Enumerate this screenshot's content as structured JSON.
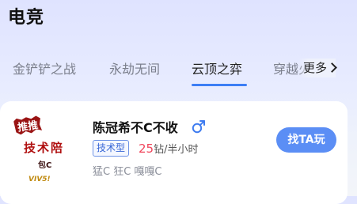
{
  "page": {
    "title": "电竞"
  },
  "tabs": [
    {
      "label": "金铲铲之战",
      "active": false
    },
    {
      "label": "永劫无间",
      "active": false
    },
    {
      "label": "云顶之弈",
      "active": true
    },
    {
      "label": "穿越火",
      "active": false
    }
  ],
  "more": {
    "label": "更多"
  },
  "colors": {
    "accent": "#3d7ef5",
    "price": "#f0455b",
    "button": "#5b8ef5",
    "gender": "#3f7cf0"
  },
  "card": {
    "avatar": {
      "badge": "推推",
      "title": "技术陪",
      "sub": "包C",
      "sign": "VIV5!"
    },
    "name": "陈冠希不C不收",
    "gender_icon": "male-icon",
    "tag": "技术型",
    "price_value": "25",
    "price_unit": "钻/半小时",
    "games": "猛C 狂C 嘎嘎C",
    "button": "找TA玩"
  }
}
